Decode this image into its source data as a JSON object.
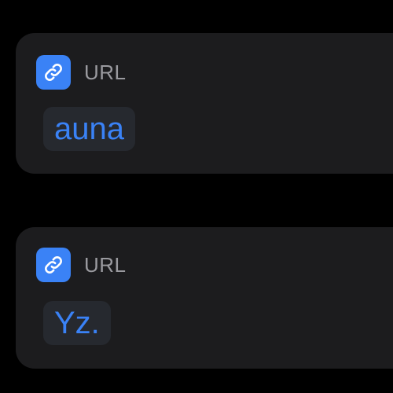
{
  "colors": {
    "background": "#000000",
    "card": "#1c1c1e",
    "accent": "#3a82f6",
    "label": "#9a9a9f",
    "token_background": "#26292f"
  },
  "cards": [
    {
      "icon": "link-icon",
      "label": "URL",
      "value": "auna"
    },
    {
      "icon": "link-icon",
      "label": "URL",
      "value": "Yz."
    }
  ]
}
